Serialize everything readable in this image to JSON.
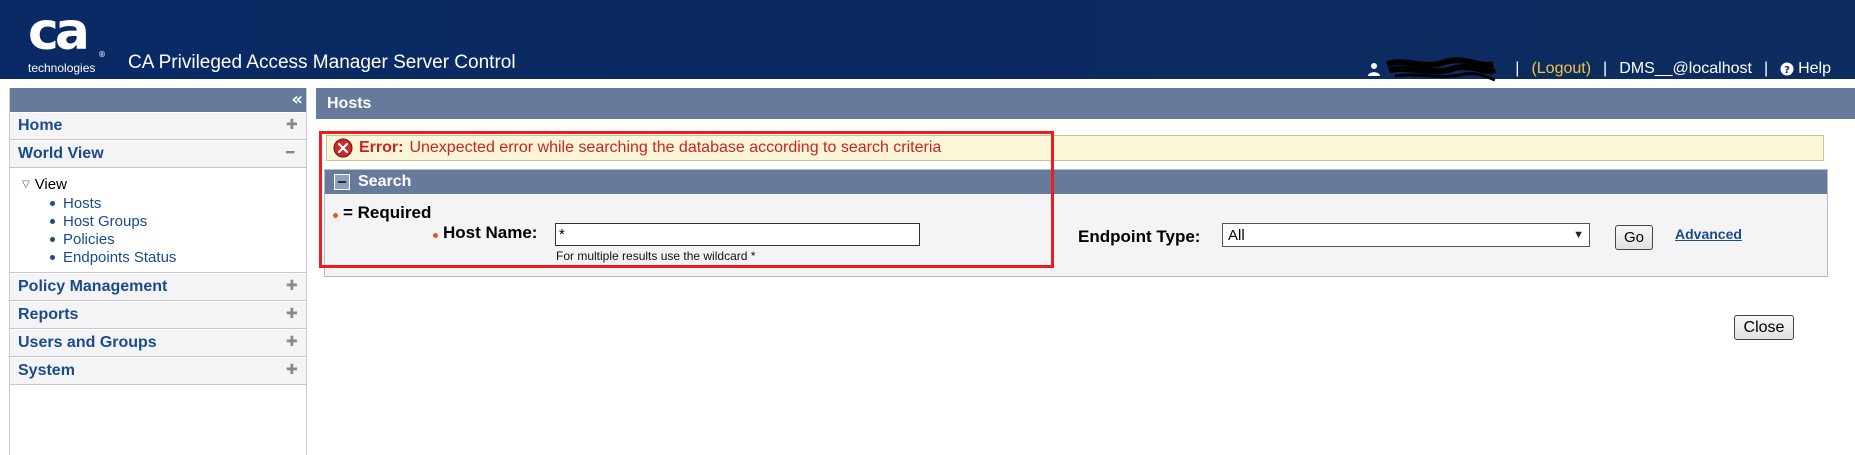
{
  "header": {
    "logo_text": "ca",
    "logo_subtext": "technologies",
    "app_title": "CA Privileged Access Manager Server Control",
    "logout_label": "(Logout)",
    "host_label": "DMS__@localhost",
    "help_label": "Help",
    "separator": "|"
  },
  "sidebar": {
    "items": [
      {
        "label": "Home"
      },
      {
        "label": "World View"
      },
      {
        "label": "Policy Management"
      },
      {
        "label": "Reports"
      },
      {
        "label": "Users and Groups"
      },
      {
        "label": "System"
      }
    ],
    "world_view_tree": {
      "root_label": "View",
      "children": [
        "Hosts",
        "Host Groups",
        "Policies",
        "Endpoints Status"
      ]
    }
  },
  "main": {
    "title": "Hosts",
    "error": {
      "label": "Error:",
      "message": "Unexpected error while searching the database according to search criteria"
    },
    "search": {
      "header": "Search",
      "required_legend": "= Required",
      "host_name_label": "Host Name:",
      "host_name_value": "*",
      "wildcard_hint": "For multiple results use the wildcard *",
      "endpoint_type_label": "Endpoint Type:",
      "endpoint_type_value": "All",
      "go_label": "Go",
      "advanced_label": "Advanced"
    },
    "close_label": "Close"
  },
  "colors": {
    "header_bg": "#0b2a62",
    "panel_header": "#667b9c",
    "nav_link": "#1a4b8a",
    "error_text": "#cc2222",
    "error_bg": "#fbf6d8",
    "logout": "#f5c242",
    "annotation_box": "#ee1c1c"
  },
  "icons": {
    "user": "user-icon",
    "help": "help-circle-icon",
    "collapse": "double-chevron-left-icon",
    "expand": "plus-icon",
    "collapse_section": "minus-icon",
    "error": "error-x-circle-icon",
    "tree_toggle": "triangle-down-icon"
  }
}
